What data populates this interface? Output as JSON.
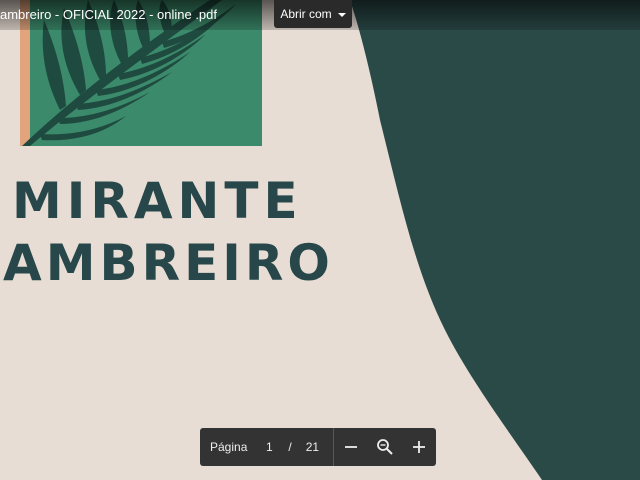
{
  "document": {
    "title": "ambreiro - OFICIAL 2022 - online .pdf",
    "cover_title_line1": "MIRANTE",
    "cover_title_line2": "AMBREIRO"
  },
  "toolbar": {
    "open_with_label": "Abrir com"
  },
  "page_controls": {
    "page_label": "Página",
    "current_page": "1",
    "separator": "/",
    "total_pages": "21"
  },
  "icons": {
    "zoom_out": "minus-icon",
    "zoom": "magnifier-icon",
    "zoom_in": "plus-icon",
    "dropdown": "chevron-down-icon"
  },
  "colors": {
    "background": "#e8ddd4",
    "dark_green": "#2a4a48",
    "panel_green": "#3b8a6b",
    "leaf_green": "#1f4a3f",
    "peach": "#e2a47c",
    "title_text": "#28474a",
    "control_bg": "#333333"
  }
}
